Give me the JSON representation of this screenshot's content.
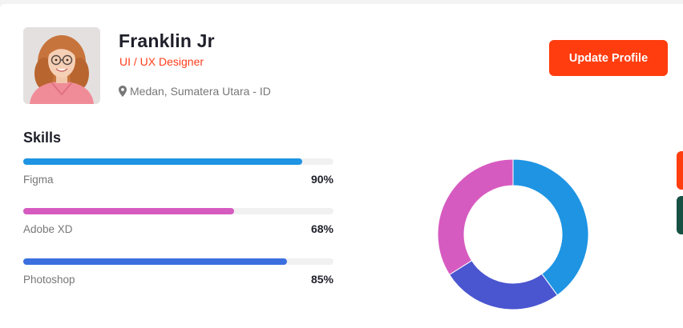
{
  "profile": {
    "name": "Franklin Jr",
    "role": "UI / UX Designer",
    "location": "Medan, Sumatera Utara - ID",
    "update_label": "Update Profile"
  },
  "skills": {
    "title": "Skills",
    "items": [
      {
        "label": "Figma",
        "percent_text": "90%",
        "value": 90,
        "color": "#1e94e3"
      },
      {
        "label": "Adobe XD",
        "percent_text": "68%",
        "value": 68,
        "color": "#d65bc0"
      },
      {
        "label": "Photoshop",
        "percent_text": "85%",
        "value": 85,
        "color": "#3b6fe0"
      }
    ]
  },
  "chart_data": {
    "type": "pie",
    "segments": [
      {
        "value": 40,
        "color": "#1e94e3"
      },
      {
        "value": 26,
        "color": "#4a55d0"
      },
      {
        "value": 34,
        "color": "#d65bc0"
      }
    ]
  },
  "colors": {
    "accent": "#ff3d0f",
    "side_tab_primary": "#ff3d0f",
    "side_tab_secondary": "#175143"
  }
}
